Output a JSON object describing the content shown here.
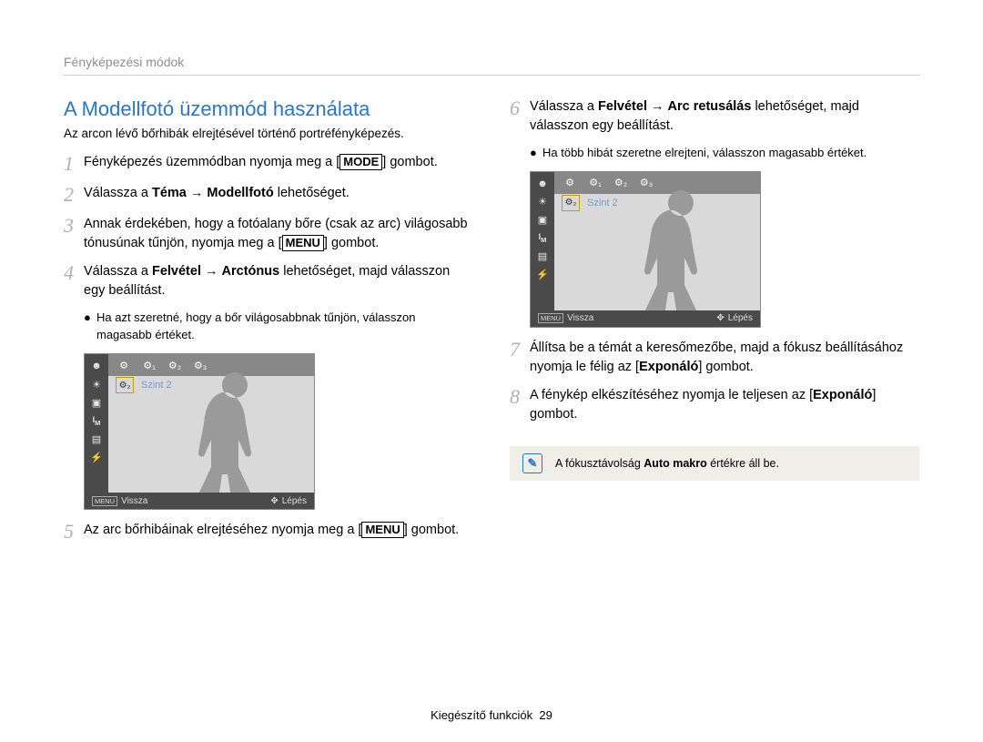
{
  "breadcrumb": "Fényképezési módok",
  "section_title": "A Modellfotó üzemmód használata",
  "subtitle": "Az arcon lévő bőrhibák elrejtésével történő portréfényképezés.",
  "steps_left": [
    {
      "num": "1",
      "html": "Fényképezés üzemmódban nyomja meg a [<span class='keycap-box'>MODE</span>] gombot."
    },
    {
      "num": "2",
      "html": "Válassza a <b>Téma</b> → <b>Modellfotó</b> lehetőséget."
    },
    {
      "num": "3",
      "html": "Annak érdekében, hogy a fotóalany bőre (csak az arc) világosabb tónusúnak tűnjön, nyomja meg a [<span class='keycap-box'>MENU</span>] gombot."
    },
    {
      "num": "4",
      "html": "Válassza a <b>Felvétel</b> → <b>Arctónus</b> lehetőséget, majd válasszon egy beállítást."
    }
  ],
  "bullet_left_4": "Ha azt szeretné, hogy a bőr világosabbnak tűnjön, válasszon magasabb értéket.",
  "steps_left_after": [
    {
      "num": "5",
      "html": "Az arc bőrhibáinak elrejtéséhez nyomja meg a [<span class='keycap-box'>MENU</span>] gombot."
    }
  ],
  "steps_right": [
    {
      "num": "6",
      "html": "Válassza a <b>Felvétel</b> → <b>Arc retusálás</b> lehetőséget, majd válasszon egy beállítást."
    }
  ],
  "bullet_right_6": "Ha több hibát szeretne elrejteni, válasszon magasabb értéket.",
  "steps_right_after": [
    {
      "num": "7",
      "html": "Állítsa be a témát a keresőmezőbe, majd a fókusz beállításához nyomja le félig az [<b>Exponáló</b>] gombot."
    },
    {
      "num": "8",
      "html": "A fénykép elkészítéséhez nyomja le teljesen az [<b>Exponáló</b>] gombot."
    }
  ],
  "lcd": {
    "topbar_icons": [
      "⚙",
      "⚙₁",
      "⚙₂",
      "⚙₃"
    ],
    "selected_tile": "⚙₂",
    "szint_label": "Szint 2",
    "bottom_left_key": "MENU",
    "bottom_left_label": "Vissza",
    "bottom_right_key": "✥",
    "bottom_right_label": "Lépés"
  },
  "note": {
    "text_html": "A fókusztávolság <b>Auto makro</b> értékre áll be."
  },
  "footer": {
    "section": "Kiegészítő funkciók",
    "page": "29"
  }
}
